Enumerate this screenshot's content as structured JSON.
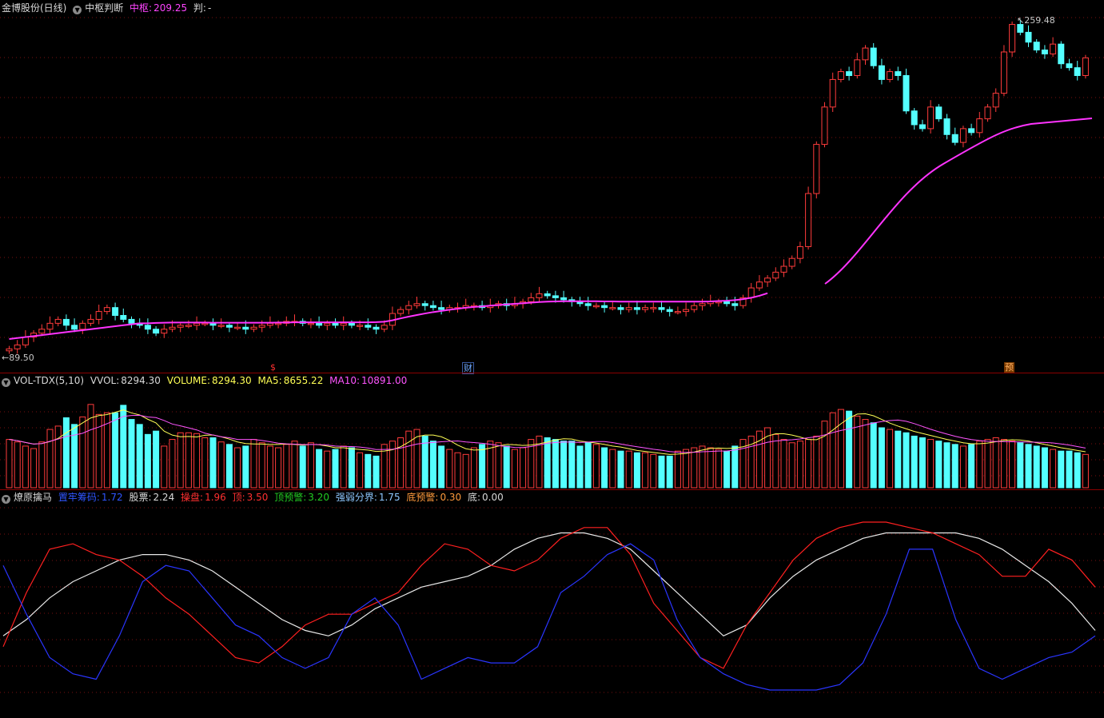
{
  "kline": {
    "title": "金博股份(日线)",
    "indicator_name": "中枢判断",
    "zs_label": "中枢:",
    "zs_value": "209.25",
    "pan_label": "判:",
    "pan_value": "-",
    "high_label": "259.48",
    "low_label": "89.50",
    "markers": [
      {
        "text": "$",
        "color": "#ff3030"
      },
      {
        "text": "财",
        "color": "#6fa8ff"
      },
      {
        "text": "预",
        "color": "#ff9a3c"
      }
    ]
  },
  "volume": {
    "name": "VOL-TDX(5,10)",
    "vvol_label": "VVOL:",
    "vvol_value": "8294.30",
    "volume_label": "VOLUME:",
    "volume_value": "8294.30",
    "ma5_label": "MA5:",
    "ma5_value": "8655.22",
    "ma10_label": "MA10:",
    "ma10_value": "10891.00"
  },
  "indicator": {
    "name": "燎原擒马",
    "items": [
      {
        "label": "置牢筹码:",
        "value": "1.72",
        "color": "#2f55ff"
      },
      {
        "label": "股票:",
        "value": "2.24",
        "color": "#d8d8d8"
      },
      {
        "label": "操盘:",
        "value": "1.96",
        "color": "#ff3030"
      },
      {
        "label": "顶:",
        "value": "3.50",
        "color": "#ff3030"
      },
      {
        "label": "顶预警:",
        "value": "3.20",
        "color": "#22cc22"
      },
      {
        "label": "强弱分界:",
        "value": "1.75",
        "color": "#8fc8ff"
      },
      {
        "label": "底预警:",
        "value": "0.30",
        "color": "#ff9a3c"
      },
      {
        "label": "底:",
        "value": "0.00",
        "color": "#d8d8d8"
      }
    ]
  },
  "colors": {
    "up": "#ff3b3b",
    "down": "#54ffff",
    "ma": "#ff33ff",
    "vol_ma5": "#ffff55",
    "vol_ma10": "#ff55ff",
    "osc_red": "#ff2020",
    "osc_white": "#e8e8e8",
    "osc_blue": "#2a35ff",
    "grid": "#7a1010"
  },
  "chart_data": {
    "type": "candlestick",
    "price_range": [
      89.5,
      259.48
    ],
    "closes": [
      91,
      93,
      97,
      99,
      101,
      104,
      106,
      103,
      101,
      104,
      106,
      110,
      112,
      108,
      106,
      104,
      103,
      101,
      99,
      101,
      102,
      103,
      103,
      104,
      104,
      103,
      103,
      102,
      102,
      101,
      102,
      103,
      104,
      104,
      105,
      105,
      104,
      104,
      103,
      104,
      103,
      104,
      103,
      103,
      102,
      101,
      103,
      109,
      111,
      113,
      114,
      113,
      112,
      111,
      112,
      112,
      113,
      113,
      112,
      113,
      114,
      113,
      114,
      115,
      117,
      119,
      118,
      117,
      116,
      115,
      114,
      113,
      113,
      112,
      112,
      111,
      112,
      111,
      112,
      112,
      111,
      110,
      110,
      111,
      113,
      114,
      115,
      115,
      114,
      113,
      117,
      122,
      125,
      127,
      130,
      133,
      137,
      143,
      170,
      195,
      214,
      228,
      232,
      230,
      238,
      244,
      235,
      228,
      232,
      230,
      212,
      205,
      203,
      214,
      208,
      200,
      196,
      203,
      201,
      208,
      214,
      221,
      242,
      256,
      252,
      247,
      243,
      241,
      246,
      236,
      234,
      230,
      239
    ],
    "ma_values": [
      96,
      96.5,
      97,
      97.5,
      98,
      98.5,
      99,
      99.5,
      100,
      100.5,
      101,
      101.5,
      102,
      102.5,
      103,
      103.5,
      104,
      104,
      104.2,
      104.3,
      104.4,
      104.4,
      104.4,
      104.4,
      104.4,
      104.3,
      104.3,
      104.3,
      104.3,
      104.3,
      104.3,
      104.3,
      104.3,
      104.4,
      104.4,
      104.5,
      104.5,
      104.5,
      104.5,
      104.5,
      104.5,
      104.5,
      104.5,
      104.5,
      104.5,
      104.6,
      104.8,
      105.5,
      106.5,
      107.4,
      108.2,
      109,
      109.7,
      110.3,
      110.9,
      111.4,
      111.9,
      112.3,
      112.6,
      113,
      113.3,
      113.6,
      113.9,
      114.2,
      114.5,
      114.8,
      115,
      115.1,
      115.2,
      115.2,
      115.2,
      115.2,
      115.2,
      115.1,
      115.1,
      115,
      115,
      115,
      115,
      115,
      115,
      115,
      115,
      115,
      115,
      115,
      115.1,
      115.3,
      115.5,
      115.8,
      116.3,
      117,
      118,
      119.3,
      null,
      null,
      null,
      null,
      null,
      null,
      null,
      null,
      null,
      null,
      null,
      null,
      null,
      null,
      null,
      null,
      null,
      null,
      null,
      null,
      null,
      null,
      null,
      null,
      null,
      null,
      null,
      null,
      null,
      null,
      null,
      null,
      null,
      null,
      null,
      null
    ],
    "volumes": [
      58,
      55,
      50,
      47,
      55,
      70,
      74,
      84,
      76,
      85,
      100,
      88,
      90,
      90,
      99,
      82,
      76,
      64,
      68,
      50,
      58,
      66,
      66,
      65,
      60,
      60,
      55,
      52,
      48,
      50,
      58,
      54,
      50,
      48,
      52,
      56,
      50,
      54,
      46,
      44,
      46,
      50,
      48,
      42,
      40,
      38,
      52,
      56,
      60,
      68,
      70,
      62,
      56,
      50,
      46,
      42,
      40,
      48,
      52,
      56,
      54,
      50,
      46,
      48,
      58,
      62,
      60,
      58,
      56,
      56,
      50,
      54,
      52,
      48,
      46,
      44,
      44,
      42,
      42,
      40,
      38,
      38,
      44,
      46,
      48,
      50,
      48,
      46,
      44,
      50,
      58,
      62,
      68,
      72,
      64,
      58,
      54,
      56,
      58,
      62,
      80,
      90,
      94,
      92,
      86,
      82,
      78,
      72,
      70,
      68,
      66,
      62,
      60,
      58,
      56,
      54,
      52,
      50,
      52,
      56,
      58,
      60,
      58,
      56,
      54,
      52,
      50,
      48,
      46,
      44,
      44,
      42,
      40
    ],
    "osc_white": [
      2.0,
      2.3,
      2.7,
      3.0,
      3.2,
      3.4,
      3.5,
      3.5,
      3.4,
      3.2,
      2.9,
      2.6,
      2.3,
      2.1,
      2.0,
      2.2,
      2.5,
      2.7,
      2.9,
      3.0,
      3.1,
      3.3,
      3.6,
      3.8,
      3.9,
      3.9,
      3.8,
      3.6,
      3.2,
      2.8,
      2.4,
      2.0,
      2.2,
      2.7,
      3.1,
      3.4,
      3.6,
      3.8,
      3.9,
      3.9,
      3.9,
      3.9,
      3.8,
      3.6,
      3.3,
      3.0,
      2.6,
      2.1
    ],
    "osc_red": [
      1.8,
      2.8,
      3.6,
      3.7,
      3.5,
      3.4,
      3.1,
      2.7,
      2.4,
      2.0,
      1.6,
      1.5,
      1.8,
      2.2,
      2.4,
      2.4,
      2.6,
      2.8,
      3.3,
      3.7,
      3.6,
      3.3,
      3.2,
      3.4,
      3.8,
      4.0,
      4.0,
      3.5,
      2.6,
      2.1,
      1.6,
      1.4,
      2.2,
      2.8,
      3.4,
      3.8,
      4.0,
      4.1,
      4.1,
      4.0,
      3.9,
      3.7,
      3.5,
      3.1,
      3.1,
      3.6,
      3.4,
      2.9
    ],
    "osc_blue": [
      3.3,
      2.4,
      1.6,
      1.3,
      1.2,
      2.0,
      3.0,
      3.3,
      3.2,
      2.7,
      2.2,
      2.0,
      1.6,
      1.4,
      1.6,
      2.4,
      2.7,
      2.2,
      1.2,
      1.4,
      1.6,
      1.5,
      1.5,
      1.8,
      2.8,
      3.1,
      3.5,
      3.7,
      3.4,
      2.3,
      1.6,
      1.3,
      1.1,
      1.0,
      1.0,
      1.0,
      1.1,
      1.5,
      2.4,
      3.6,
      3.6,
      2.3,
      1.4,
      1.2,
      1.4,
      1.6,
      1.7,
      2.0
    ]
  }
}
